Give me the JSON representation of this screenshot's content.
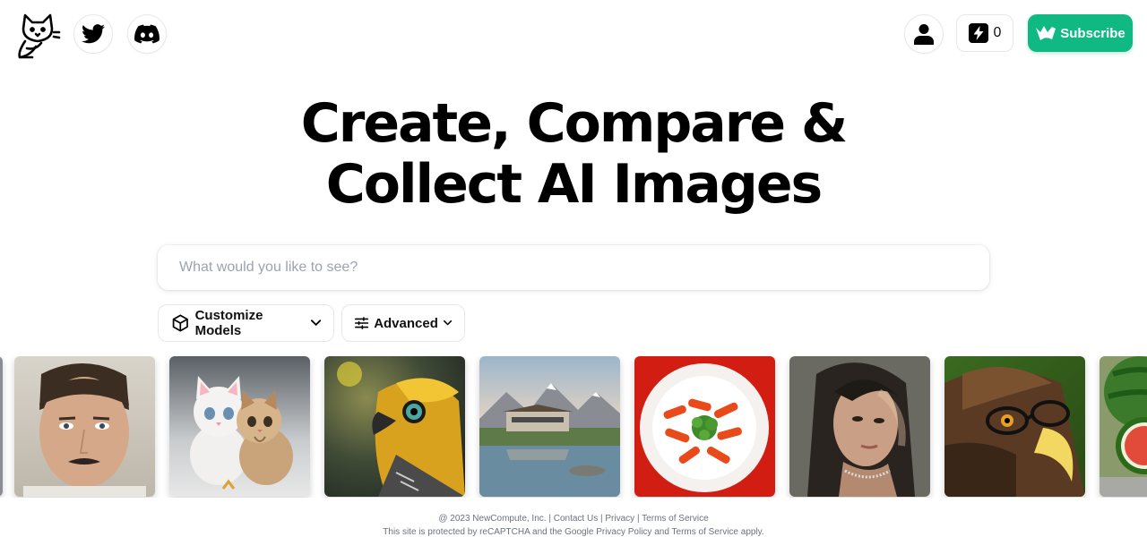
{
  "header": {
    "logo_icon": "cat-logo-icon",
    "social": [
      {
        "icon": "twitter-icon"
      },
      {
        "icon": "discord-icon"
      }
    ],
    "account_icon": "user-icon",
    "credits": {
      "icon": "lightning-icon",
      "count": "0"
    },
    "subscribe": {
      "icon": "crown-icon",
      "label": "Subscribe",
      "color": "#10b981"
    }
  },
  "hero": {
    "title_line1": "Create, Compare &",
    "title_line2": "Collect AI Images"
  },
  "search": {
    "placeholder": "What would you like to see?",
    "value": ""
  },
  "controls": {
    "customize_models": {
      "icon": "cube-icon",
      "label": "Customize Models",
      "chevron": "chevron-down-icon"
    },
    "advanced": {
      "icon": "sliders-icon",
      "label": "Advanced",
      "chevron": "chevron-down-icon"
    }
  },
  "gallery": {
    "images": [
      {
        "subject": "man-portrait"
      },
      {
        "subject": "kittens"
      },
      {
        "subject": "yellow-bird"
      },
      {
        "subject": "mountain-house"
      },
      {
        "subject": "carrot-plate"
      },
      {
        "subject": "woman-portrait"
      },
      {
        "subject": "eagle-glasses"
      },
      {
        "subject": "watermelon"
      }
    ]
  },
  "footer": {
    "copyright": "@ 2023 NewCompute, Inc.",
    "sep": "|",
    "contact": "Contact Us",
    "privacy": "Privacy",
    "terms": "Terms of Service",
    "recaptcha_prefix": "This site is protected by reCAPTCHA and the Google",
    "google_privacy": "Privacy Policy",
    "and": "and",
    "google_terms": "Terms of Service",
    "apply": "apply."
  }
}
